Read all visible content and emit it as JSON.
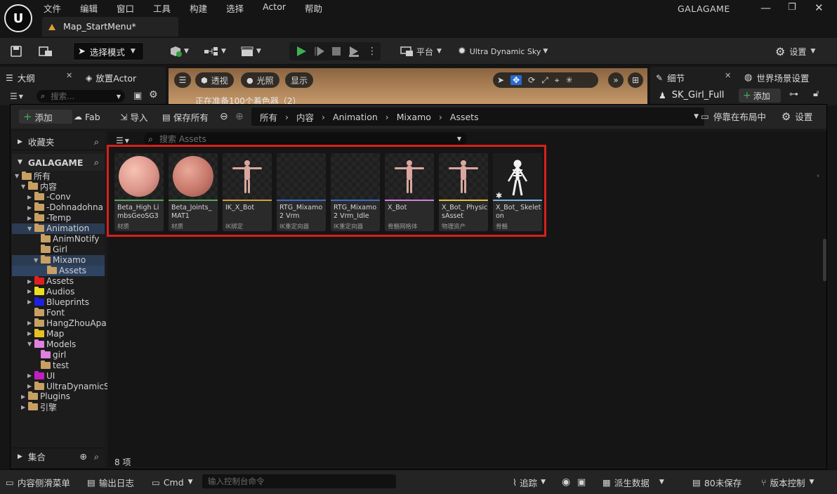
{
  "menu": [
    "文件",
    "编辑",
    "窗口",
    "工具",
    "构建",
    "选择",
    "Actor",
    "帮助"
  ],
  "map_tab": "Map_StartMenu*",
  "project_name": "GALAGAME",
  "toolbar": {
    "mode": "选择模式",
    "platform": "平台",
    "sky": "Ultra Dynamic Sky",
    "settings": "设置"
  },
  "outliner": {
    "tab": "大纲",
    "place_actor": "放置Actor",
    "search_placeholder": "搜索..."
  },
  "viewport": {
    "perspective": "透视",
    "lit": "光照",
    "show": "显示",
    "status_text": "正在准备100个着色器（2）"
  },
  "details": {
    "tab": "细节",
    "world_settings": "世界场景设置",
    "actor_name": "SK_Girl_Full",
    "add": "添加"
  },
  "content_browser": {
    "add": "添加",
    "fab": "Fab",
    "import": "导入",
    "save_all": "保存所有",
    "breadcrumbs": [
      "所有",
      "内容",
      "Animation",
      "Mixamo",
      "Assets"
    ],
    "dock": "停靠在布局中",
    "settings": "设置",
    "search_placeholder": "搜索 Assets",
    "favorites": "收藏夹",
    "project": "GALAGAME",
    "collections": "集合",
    "item_count": "8 项"
  },
  "tree": [
    {
      "label": "所有",
      "depth": 0,
      "color": "#c8a063",
      "open": true
    },
    {
      "label": "内容",
      "depth": 1,
      "color": "#c8a063",
      "open": true
    },
    {
      "label": "-Conv",
      "depth": 2,
      "color": "#c8a063"
    },
    {
      "label": "-Dohnadohna",
      "depth": 2,
      "color": "#c8a063"
    },
    {
      "label": "-Temp",
      "depth": 2,
      "color": "#c8a063"
    },
    {
      "label": "Animation",
      "depth": 2,
      "color": "#c8a063",
      "open": true
    },
    {
      "label": "AnimNotify",
      "depth": 3,
      "color": "#c8a063"
    },
    {
      "label": "Girl",
      "depth": 3,
      "color": "#c8a063"
    },
    {
      "label": "Mixamo",
      "depth": 3,
      "color": "#c8a063",
      "open": true
    },
    {
      "label": "Assets",
      "depth": 4,
      "color": "#c8a063"
    },
    {
      "label": "Assets",
      "depth": 2,
      "color": "#e02020"
    },
    {
      "label": "Audios",
      "depth": 2,
      "color": "#e8e020"
    },
    {
      "label": "Blueprints",
      "depth": 2,
      "color": "#2020e0"
    },
    {
      "label": "Font",
      "depth": 2,
      "color": "#c8a063"
    },
    {
      "label": "HangZhouApa",
      "depth": 2,
      "color": "#c8a063"
    },
    {
      "label": "Map",
      "depth": 2,
      "color": "#e8c020"
    },
    {
      "label": "Models",
      "depth": 2,
      "color": "#e080e0",
      "open": true
    },
    {
      "label": "girl",
      "depth": 3,
      "color": "#e080e0"
    },
    {
      "label": "test",
      "depth": 3,
      "color": "#c8a063"
    },
    {
      "label": "UI",
      "depth": 2,
      "color": "#c020c0"
    },
    {
      "label": "UltraDynamicS",
      "depth": 2,
      "color": "#c8a063"
    },
    {
      "label": "Plugins",
      "depth": 1,
      "color": "#c8a063"
    },
    {
      "label": "引擎",
      "depth": 1,
      "color": "#c8a063"
    }
  ],
  "assets": [
    {
      "name": "Beta_High LimbsGeoSG3",
      "type": "材质",
      "strip": "#5aa05a",
      "thumb": "sphere-pink"
    },
    {
      "name": "Beta_Joints_ MAT1",
      "type": "材质",
      "strip": "#5aa05a",
      "thumb": "sphere-rose"
    },
    {
      "name": "IK_X_Bot",
      "type": "IK绑定",
      "strip": "#d0a040",
      "thumb": "tpose"
    },
    {
      "name": "RTG_Mixamo2 Vrm",
      "type": "IK重定向器",
      "strip": "#3a6ec0",
      "thumb": "empty"
    },
    {
      "name": "RTG_Mixamo2 Vrm_Idle",
      "type": "IK重定向器",
      "strip": "#3a6ec0",
      "thumb": "empty"
    },
    {
      "name": "X_Bot",
      "type": "骨骼网格体",
      "strip": "#d080e0",
      "thumb": "tpose"
    },
    {
      "name": "X_Bot_ PhysicsAsset",
      "type": "物理资产",
      "strip": "#e0c040",
      "thumb": "tpose"
    },
    {
      "name": "X_Bot_ Skeleton",
      "type": "骨骼",
      "strip": "#7ab0e0",
      "thumb": "skeleton"
    }
  ],
  "statusbar": {
    "content_drawer": "内容侧滑菜单",
    "output_log": "输出日志",
    "cmd": "Cmd",
    "cmd_placeholder": "输入控制台命令",
    "trace": "追踪",
    "derived_data": "派生数据",
    "unsaved": "80未保存",
    "source_control": "版本控制"
  }
}
